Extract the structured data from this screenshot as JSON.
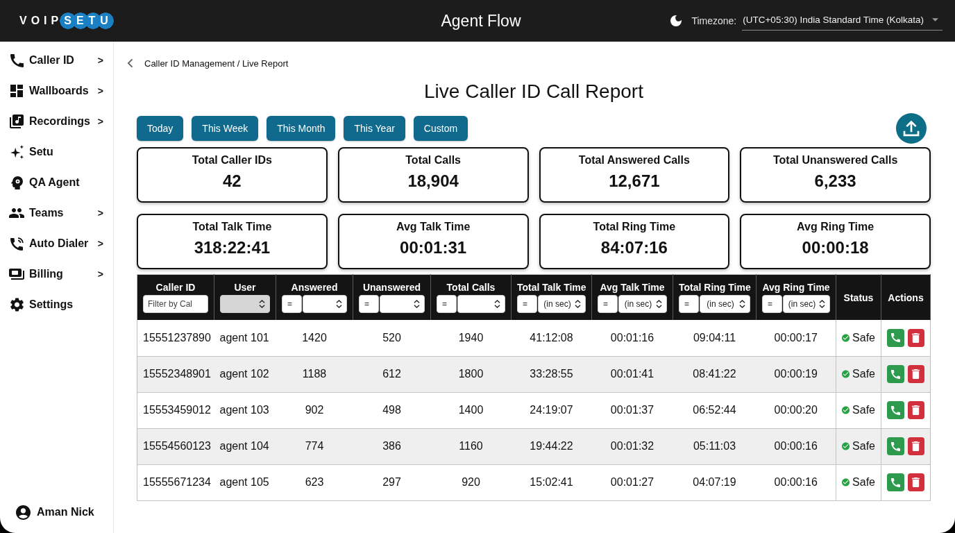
{
  "header": {
    "logo": {
      "text": "VOIP",
      "badge": "SETU"
    },
    "title": "Agent Flow",
    "timezone": {
      "label": "Timezone:",
      "value": "(UTC+05:30) India Standard Time (Kolkata)"
    }
  },
  "sidebar": {
    "items": [
      {
        "label": "Caller ID",
        "arrow": ">"
      },
      {
        "label": "Wallboards",
        "arrow": ">"
      },
      {
        "label": "Recordings",
        "arrow": ">"
      },
      {
        "label": "Setu"
      },
      {
        "label": "QA Agent"
      },
      {
        "label": "Teams",
        "arrow": ">"
      },
      {
        "label": "Auto Dialer",
        "arrow": ">"
      },
      {
        "label": "Billing",
        "arrow": ">"
      },
      {
        "label": "Settings"
      }
    ],
    "user": "Aman Nick"
  },
  "breadcrumb": "Caller ID Management / Live Report",
  "title": "Live Caller ID Call Report",
  "ranges": [
    {
      "label": "Today"
    },
    {
      "label": "This Week"
    },
    {
      "label": "This Month"
    },
    {
      "label": "This Year"
    },
    {
      "label": "Custom"
    }
  ],
  "stats": [
    {
      "label": "Total Caller IDs",
      "value": "42"
    },
    {
      "label": "Total Calls",
      "value": "18,904"
    },
    {
      "label": "Total Answered Calls",
      "value": "12,671"
    },
    {
      "label": "Total Unanswered Calls",
      "value": "6,233"
    },
    {
      "label": "Total Talk Time",
      "value": "318:22:41"
    },
    {
      "label": "Avg Talk Time",
      "value": "00:01:31"
    },
    {
      "label": "Total Ring Time",
      "value": "84:07:16"
    },
    {
      "label": "Avg Ring Time",
      "value": "00:00:18"
    }
  ],
  "table": {
    "columns": [
      {
        "label": "Caller ID",
        "filter": {
          "kind": "text",
          "placeholder": "Filter by Cal",
          "disabled": false
        }
      },
      {
        "label": "User",
        "filter": {
          "kind": "select",
          "disabled": true
        }
      },
      {
        "label": "Answered",
        "filter": {
          "kind": "compare",
          "operator": "=",
          "disabled": false
        }
      },
      {
        "label": "Unanswered",
        "filter": {
          "kind": "compare",
          "operator": "=",
          "disabled": false
        }
      },
      {
        "label": "Total Calls",
        "filter": {
          "kind": "compare",
          "operator": "=",
          "disabled": false
        }
      },
      {
        "label": "Total Talk Time",
        "filter": {
          "kind": "compare",
          "operator": "=",
          "unit": "(in sec)",
          "disabled": false
        }
      },
      {
        "label": "Avg Talk Time",
        "filter": {
          "kind": "compare",
          "operator": "=",
          "unit": "(in sec)",
          "disabled": false
        }
      },
      {
        "label": "Total Ring Time",
        "filter": {
          "kind": "compare",
          "operator": "=",
          "unit": "(in sec)",
          "disabled": false
        }
      },
      {
        "label": "Avg Ring Time",
        "filter": {
          "kind": "compare",
          "operator": "=",
          "unit": "(in sec)",
          "disabled": false
        }
      },
      {
        "label": "Status"
      },
      {
        "label": "Actions"
      }
    ],
    "rows": [
      {
        "cells": [
          "15551237890",
          "agent 101",
          "1420",
          "520",
          "1940",
          "41:12:08",
          "00:01:16",
          "09:04:11",
          "00:00:17"
        ],
        "status": "Safe"
      },
      {
        "cells": [
          "15552348901",
          "agent 102",
          "1188",
          "612",
          "1800",
          "33:28:55",
          "00:01:41",
          "08:41:22",
          "00:00:19"
        ],
        "status": "Safe"
      },
      {
        "cells": [
          "15553459012",
          "agent 103",
          "902",
          "498",
          "1400",
          "24:19:07",
          "00:01:37",
          "06:52:44",
          "00:00:20"
        ],
        "status": "Safe"
      },
      {
        "cells": [
          "15554560123",
          "agent 104",
          "774",
          "386",
          "1160",
          "19:44:22",
          "00:01:32",
          "05:11:03",
          "00:00:16"
        ],
        "status": "Safe"
      },
      {
        "cells": [
          "15555671234",
          "agent 105",
          "623",
          "297",
          "920",
          "15:02:41",
          "00:01:27",
          "04:07:19",
          "00:00:16"
        ],
        "status": "Safe"
      }
    ]
  }
}
